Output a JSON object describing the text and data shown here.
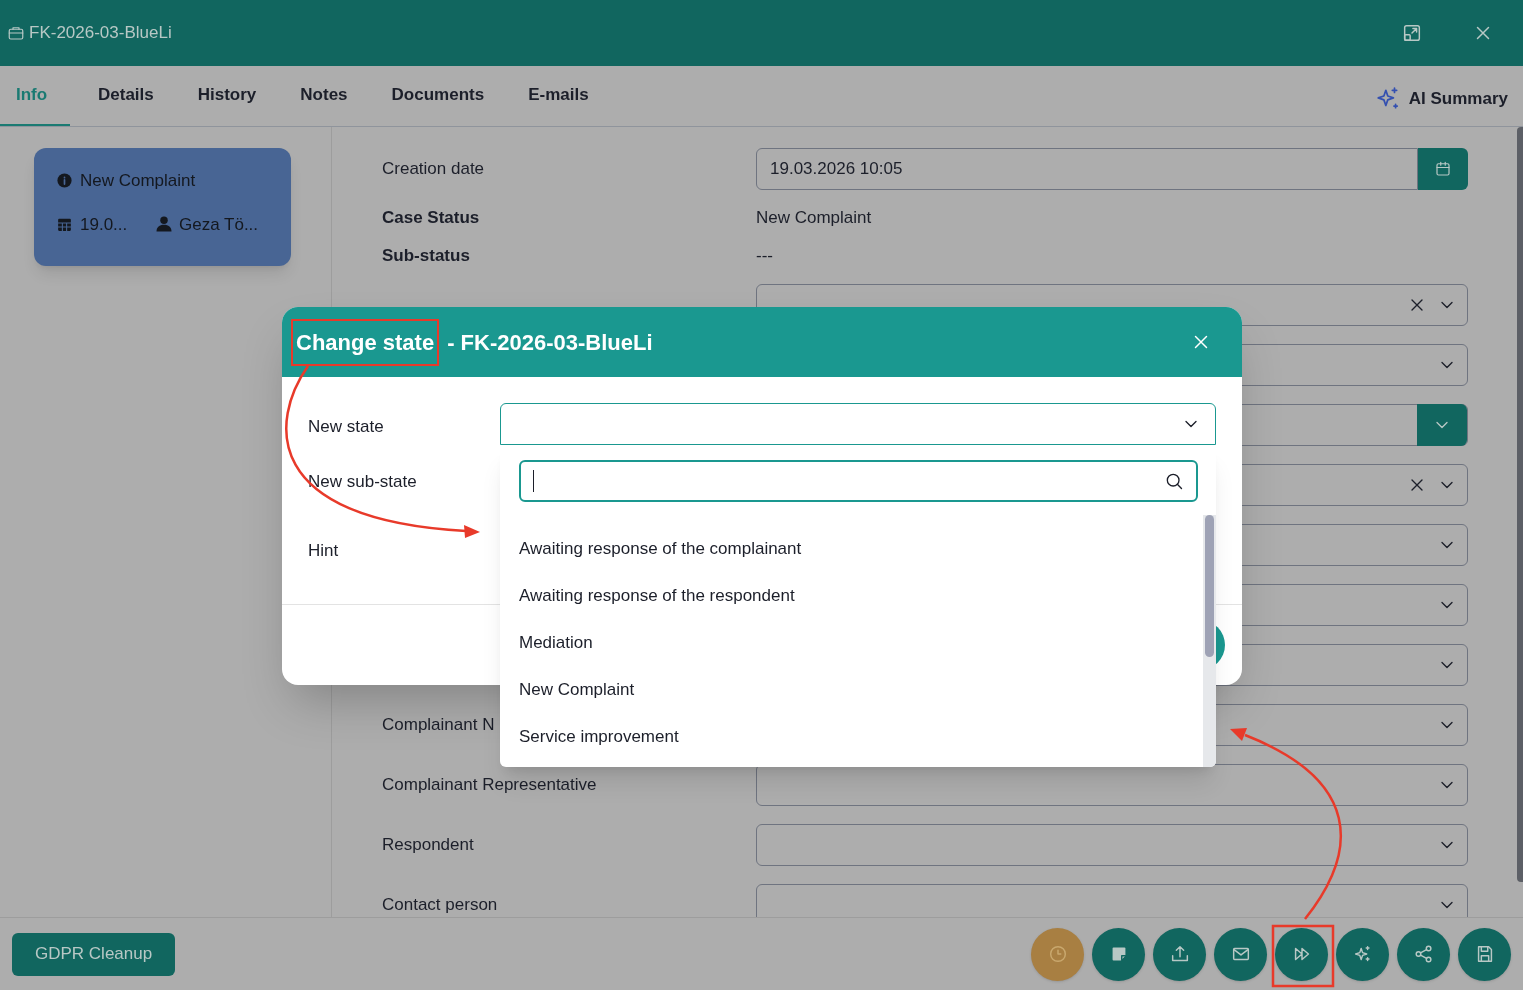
{
  "window": {
    "title": "FK-2026-03-BlueLi"
  },
  "tabs": [
    {
      "label": "Info",
      "selected": true
    },
    {
      "label": "Details",
      "selected": false
    },
    {
      "label": "History",
      "selected": false
    },
    {
      "label": "Notes",
      "selected": false
    },
    {
      "label": "Documents",
      "selected": false
    },
    {
      "label": "E-mails",
      "selected": false
    }
  ],
  "ai_summary": {
    "label": "AI Summary"
  },
  "case_card": {
    "status": "New Complaint",
    "date": "19.0...",
    "person": "Geza Tö..."
  },
  "form": [
    {
      "label": "Creation date",
      "kind": "date",
      "value": "19.03.2026 10:05"
    },
    {
      "label": "Case Status",
      "kind": "text",
      "value": "New Complaint"
    },
    {
      "label": "Sub-status",
      "kind": "text",
      "value": "---"
    },
    {
      "kind": "select",
      "clearable": true
    },
    {
      "kind": "select",
      "clearable": false
    },
    {
      "kind": "select_button",
      "clearable": false
    },
    {
      "kind": "select",
      "clearable": true
    },
    {
      "kind": "select",
      "clearable": false
    },
    {
      "kind": "select",
      "clearable": false
    },
    {
      "kind": "select",
      "clearable": false
    },
    {
      "label": "Complainant N",
      "kind": "select",
      "clearable": false
    },
    {
      "label": "Complainant Representative",
      "kind": "select",
      "clearable": false
    },
    {
      "label": "Respondent",
      "kind": "select",
      "clearable": false
    },
    {
      "label": "Contact person",
      "kind": "select",
      "clearable": false
    }
  ],
  "footer": {
    "gdpr_button": "GDPR Cleanup",
    "actions": [
      {
        "kind": "clock"
      },
      {
        "kind": "note"
      },
      {
        "kind": "upload"
      },
      {
        "kind": "mail"
      },
      {
        "kind": "forward"
      },
      {
        "kind": "sparkle"
      },
      {
        "kind": "share"
      },
      {
        "kind": "save"
      }
    ]
  },
  "dialog": {
    "title": "Change state",
    "title_case": "- FK-2026-03-BlueLi",
    "labels": [
      "New state",
      "New sub-state",
      "Hint"
    ],
    "new_state": {
      "expanded": true,
      "options": [
        "Awaiting response of the complainant",
        "Awaiting response of the respondent",
        "Mediation",
        "New Complaint",
        "Service improvement"
      ]
    }
  }
}
